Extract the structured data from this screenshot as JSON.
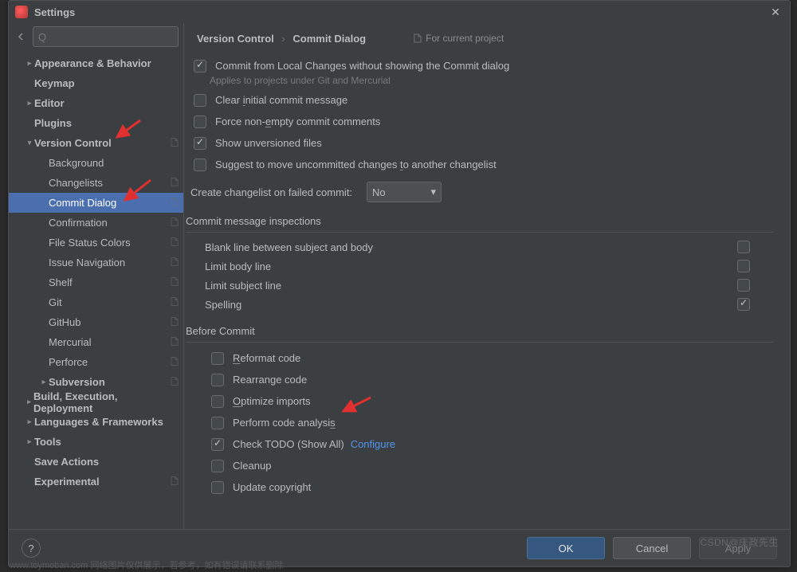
{
  "window": {
    "title": "Settings"
  },
  "search": {
    "placeholder": "Q"
  },
  "sidebar": {
    "items": [
      {
        "label": "Appearance & Behavior",
        "bold": true,
        "arrow": "▸",
        "indent": 1
      },
      {
        "label": "Keymap",
        "bold": true,
        "indent": 1
      },
      {
        "label": "Editor",
        "bold": true,
        "arrow": "▸",
        "indent": 1
      },
      {
        "label": "Plugins",
        "bold": true,
        "indent": 1
      },
      {
        "label": "Version Control",
        "bold": true,
        "arrow": "▾",
        "indent": 1,
        "badge": true
      },
      {
        "label": "Background",
        "indent": 2
      },
      {
        "label": "Changelists",
        "indent": 2,
        "badge": true
      },
      {
        "label": "Commit Dialog",
        "indent": 2,
        "badge": true,
        "selected": true
      },
      {
        "label": "Confirmation",
        "indent": 2,
        "badge": true
      },
      {
        "label": "File Status Colors",
        "indent": 2,
        "badge": true
      },
      {
        "label": "Issue Navigation",
        "indent": 2,
        "badge": true
      },
      {
        "label": "Shelf",
        "indent": 2,
        "badge": true
      },
      {
        "label": "Git",
        "indent": 2,
        "badge": true
      },
      {
        "label": "GitHub",
        "indent": 2,
        "badge": true
      },
      {
        "label": "Mercurial",
        "indent": 2,
        "badge": true
      },
      {
        "label": "Perforce",
        "indent": 2,
        "badge": true
      },
      {
        "label": "Subversion",
        "bold": true,
        "arrow": "▸",
        "indent": 2,
        "badge": true
      },
      {
        "label": "Build, Execution, Deployment",
        "bold": true,
        "arrow": "▸",
        "indent": 1
      },
      {
        "label": "Languages & Frameworks",
        "bold": true,
        "arrow": "▸",
        "indent": 1
      },
      {
        "label": "Tools",
        "bold": true,
        "arrow": "▸",
        "indent": 1
      },
      {
        "label": "Save Actions",
        "bold": true,
        "indent": 1
      },
      {
        "label": "Experimental",
        "bold": true,
        "indent": 1,
        "badge": true
      }
    ]
  },
  "breadcrumb": {
    "a": "Version Control",
    "b": "Commit Dialog"
  },
  "projectHint": "For current project",
  "options": {
    "o1": {
      "checked": true,
      "label": "Commit from Local Changes without showing the Commit dialog",
      "sub": "Applies to projects under Git and Mercurial"
    },
    "o2": {
      "checked": false,
      "pre": "Clear ",
      "u": "i",
      "post": "nitial commit message"
    },
    "o3": {
      "checked": false,
      "pre": "Force non-",
      "u": "e",
      "post": "mpty commit comments"
    },
    "o4": {
      "checked": true,
      "label": "Show unversioned files"
    },
    "o5": {
      "checked": false,
      "pre": "Suggest to move uncommitted changes ",
      "u": "t",
      "post": "o another changelist"
    },
    "changelistLabel": "Create changelist on failed commit:",
    "changelistValue": "No"
  },
  "inspections": {
    "heading": "Commit message inspections",
    "rows": [
      {
        "label": "Blank line between subject and body",
        "checked": false
      },
      {
        "label": "Limit body line",
        "checked": false
      },
      {
        "label": "Limit subject line",
        "checked": false
      },
      {
        "label": "Spelling",
        "checked": true
      }
    ]
  },
  "before": {
    "heading": "Before Commit",
    "rows": [
      {
        "checked": false,
        "pre": "",
        "u": "R",
        "post": "eformat code"
      },
      {
        "checked": false,
        "label": "Rearrange code"
      },
      {
        "checked": false,
        "pre": "",
        "u": "O",
        "post": "ptimize imports"
      },
      {
        "checked": false,
        "pre": "Perform code analysi",
        "u": "s",
        "post": ""
      },
      {
        "checked": true,
        "label": "Check TODO (Show All)",
        "link": "Configure"
      },
      {
        "checked": false,
        "label": "Cleanup"
      },
      {
        "checked": false,
        "label": "Update copyright"
      }
    ]
  },
  "footer": {
    "ok": "OK",
    "cancel": "Cancel",
    "apply": "Apply",
    "help": "?"
  },
  "watermark": "CSDN@庆政先生",
  "footnote": "www.toymoban.com 网络图片仅供展示，若参考，如有错误请联系删除"
}
